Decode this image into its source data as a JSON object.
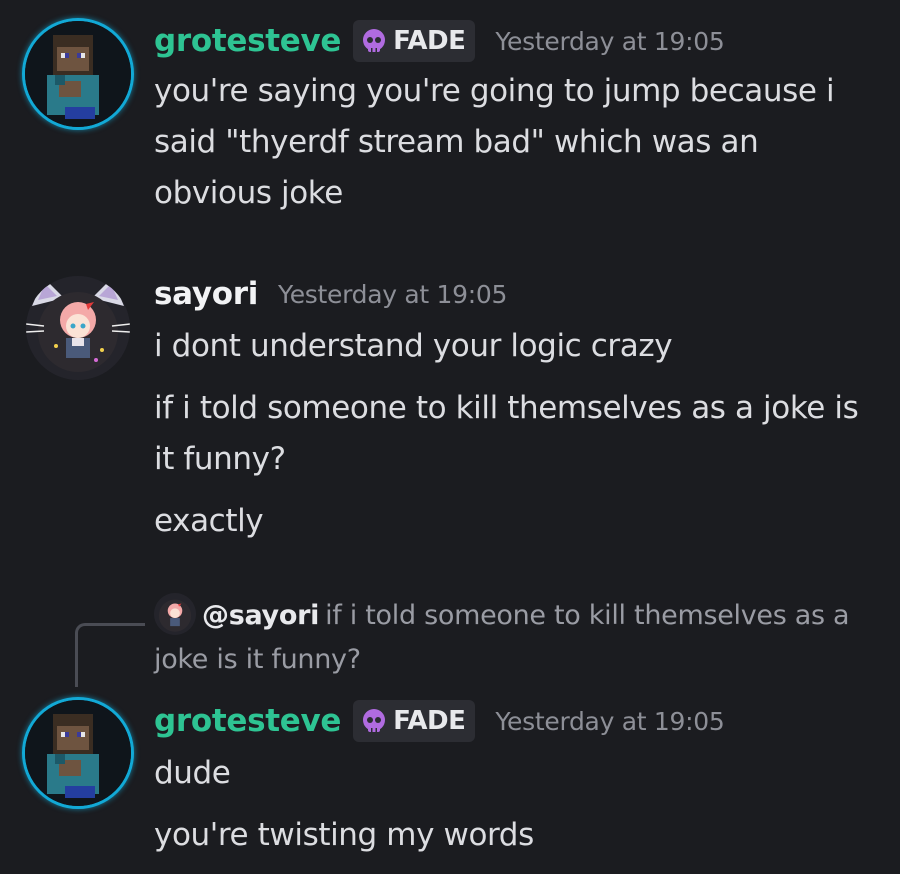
{
  "messages": [
    {
      "author": "grotesteve",
      "tag": "FADE",
      "timestamp": "Yesterday at 19:05",
      "lines": [
        "you're saying you're going to jump because i said \"thyerdf stream bad\" which was an obvious joke"
      ]
    },
    {
      "author": "sayori",
      "timestamp": "Yesterday at 19:05",
      "lines": [
        "i dont understand your logic crazy",
        "if i told someone to kill themselves as a joke is it funny?",
        "exactly"
      ]
    },
    {
      "reply": {
        "author": "@sayori",
        "text": "if i told someone to kill themselves as a joke is it funny?"
      },
      "author": "grotesteve",
      "tag": "FADE",
      "timestamp": "Yesterday at 19:05",
      "lines": [
        "dude",
        "you're twisting my words"
      ]
    }
  ],
  "colors": {
    "background": "#1b1c20",
    "grotesteve_name": "#2ec493",
    "timestamp": "#8d8f97",
    "avatar_ring": "#12a9d6",
    "tag_background": "#2c2d33"
  },
  "icons": {
    "tag_icon": "skull-icon"
  }
}
